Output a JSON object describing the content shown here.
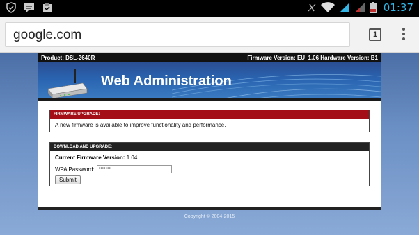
{
  "status_bar": {
    "time": "01:37",
    "left_icons": [
      "shield-icon",
      "chat-icon",
      "clipboard-icon"
    ],
    "right_icons": [
      "mute-icon",
      "wifi-icon",
      "signal-icon",
      "signal-icon",
      "battery-icon"
    ]
  },
  "browser": {
    "url": "google.com",
    "tab_count": "1"
  },
  "router_page": {
    "product": "Product: DSL-2640R",
    "firmware_info": "Firmware Version: EU_1.06   Hardware Version: B1",
    "banner_title": "Web Administration",
    "firmware_upgrade": {
      "heading": "FIRMWARE UPGRADE:",
      "message": "A new firmware is available to improve functionality and performance."
    },
    "download_upgrade": {
      "heading": "DOWNLOAD AND UPGRADE:",
      "current_label": "Current Firmware Version:",
      "current_value": "1.04",
      "password_label": "WPA Password:",
      "password_value": "•••••••",
      "submit_label": "Submit"
    },
    "copyright": "Copyright © 2004-2015"
  },
  "colors": {
    "status_time": "#33b5e5",
    "alert_header": "#a40e16",
    "banner_blue": "#2a65b2",
    "page_bg": "#6a8fc4"
  }
}
